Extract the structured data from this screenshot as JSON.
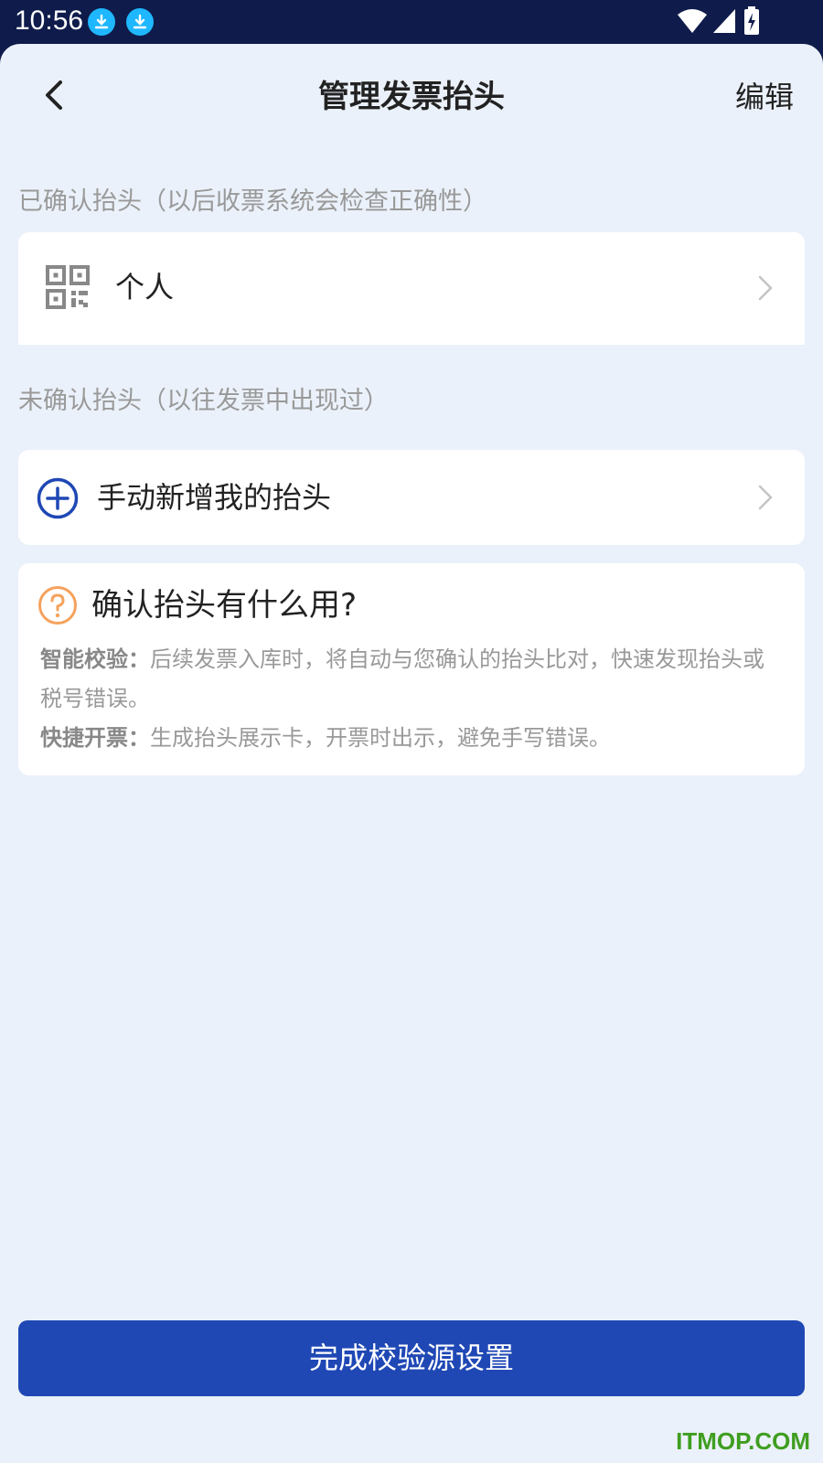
{
  "status_bar": {
    "time": "10:56"
  },
  "header": {
    "title": "管理发票抬头",
    "edit_label": "编辑"
  },
  "confirmed_section": {
    "label": "已确认抬头（以后收票系统会检查正确性）",
    "items": [
      {
        "label": "个人",
        "icon": "qr-code-icon"
      }
    ]
  },
  "unconfirmed_section": {
    "label": "未确认抬头（以往发票中出现过）",
    "add_label": "手动新增我的抬头"
  },
  "info_card": {
    "title": "确认抬头有什么用?",
    "lines": [
      {
        "term": "智能校验：",
        "text": "后续发票入库时，将自动与您确认的抬头比对，快速发现抬头或税号错误。"
      },
      {
        "term": "快捷开票：",
        "text": "生成抬头展示卡，开票时出示，避免手写错误。"
      }
    ]
  },
  "primary_button": {
    "label": "完成校验源设置"
  },
  "watermark": "ITMOP.COM",
  "colors": {
    "status_bar": "#0f1c4b",
    "background": "#ebf1fa",
    "primary": "#1f48b5",
    "question": "#f5a25d",
    "watermark": "#3f9e1f"
  }
}
